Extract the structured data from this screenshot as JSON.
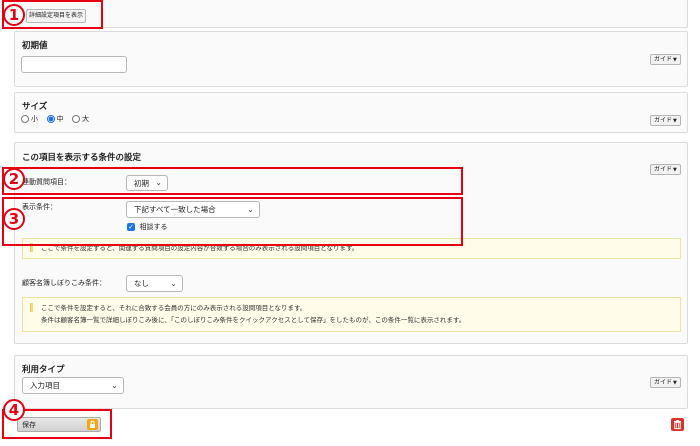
{
  "top": {
    "detail_button_label": "詳細設定項目を表示"
  },
  "initial_value": {
    "heading": "初期値",
    "input_value": "",
    "guide_label": "ガイド"
  },
  "size": {
    "heading": "サイズ",
    "options": [
      {
        "label": "小",
        "selected": false
      },
      {
        "label": "中",
        "selected": true
      },
      {
        "label": "大",
        "selected": false
      }
    ],
    "guide_label": "ガイド"
  },
  "display_condition": {
    "heading": "この項目を表示する条件の設定",
    "guide_label": "ガイド",
    "related_item": {
      "label": "連動質問項目：",
      "selected": "初期"
    },
    "condition": {
      "label": "表示条件：",
      "selected": "下記すべて一致した場合",
      "checkbox_label": "相談する",
      "checked": true
    },
    "note": "ここで条件を設定すると、関連する質問項目の設定内容が合致する場合のみ表示される設問項目となります。"
  },
  "customer_filter": {
    "label": "顧客名簿しぼりこみ条件：",
    "selected": "なし",
    "note_lines": [
      "ここで条件を設定すると、それに合致する会員の方にのみ表示される設問項目となります。",
      "条件は顧客名簿一覧で詳細しぼりこみ後に、「このしぼりこみ条件をクイックアクセスとして保存」をしたものが、この条件一覧に表示されます。"
    ]
  },
  "usage_type": {
    "heading": "利用タイプ",
    "selected": "入力項目",
    "guide_label": "ガイド"
  },
  "footer": {
    "save_label": "保存"
  },
  "annotations": {
    "n1": "1",
    "n2": "2",
    "n3": "3",
    "n4": "4"
  },
  "colors": {
    "accent_red": "#e60012",
    "checkbox_blue": "#1a73e8",
    "note_bg": "#fffcea",
    "trash_red": "#d9342b",
    "lock_orange": "#f2a516"
  }
}
